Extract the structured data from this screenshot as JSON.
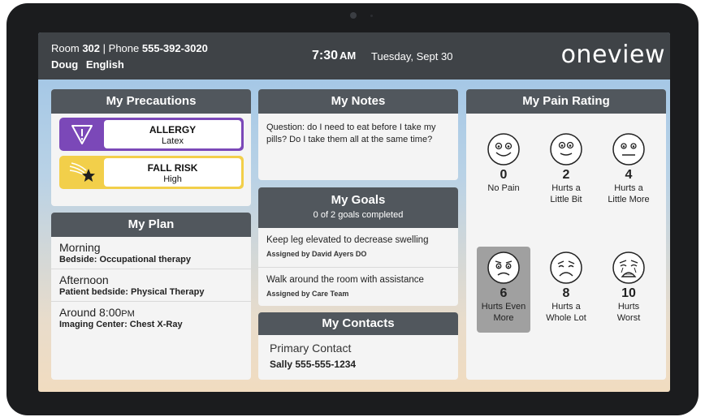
{
  "header": {
    "room_label": "Room",
    "room_number": "302",
    "separator": "|",
    "phone_label": "Phone",
    "phone_number": "555-392-3020",
    "patient_name": "Doug",
    "language": "English",
    "time": "7:30",
    "ampm": "AM",
    "date": "Tuesday, Sept 30",
    "logo": "oneview"
  },
  "precautions": {
    "title": "My Precautions",
    "items": [
      {
        "title": "ALLERGY",
        "detail": "Latex",
        "color": "#7b48b8",
        "icon": "warning-triangle-icon"
      },
      {
        "title": "FALL RISK",
        "detail": "High",
        "color": "#f2cf4a",
        "icon": "falling-star-icon"
      }
    ]
  },
  "plan": {
    "title": "My Plan",
    "items": [
      {
        "time": "Morning",
        "time_suffix": "",
        "detail": "Bedside: Occupational therapy"
      },
      {
        "time": "Afternoon",
        "time_suffix": "",
        "detail": "Patient bedside: Physical Therapy"
      },
      {
        "time": "Around 8:00",
        "time_suffix": "PM",
        "detail": "Imaging Center: Chest X-Ray"
      }
    ]
  },
  "notes": {
    "title": "My Notes",
    "text": "Question: do I need to eat before I take my pills? Do I take them all at the same time?"
  },
  "goals": {
    "title": "My Goals",
    "count_text": "0 of 2 goals completed",
    "items": [
      {
        "goal": "Keep leg elevated to decrease swelling",
        "assigned": "Assigned by David Ayers DO"
      },
      {
        "goal": "Walk around the room with assistance",
        "assigned": "Assigned by Care Team"
      }
    ]
  },
  "contacts": {
    "title": "My Contacts",
    "label": "Primary Contact",
    "value": "Sally 555-555-1234"
  },
  "pain": {
    "title": "My Pain Rating",
    "selected": "6",
    "items": [
      {
        "value": "0",
        "line1": "No Pain",
        "line2": ""
      },
      {
        "value": "2",
        "line1": "Hurts a",
        "line2": "Little Bit"
      },
      {
        "value": "4",
        "line1": "Hurts a",
        "line2": "Little More"
      },
      {
        "value": "6",
        "line1": "Hurts Even",
        "line2": "More"
      },
      {
        "value": "8",
        "line1": "Hurts a",
        "line2": "Whole Lot"
      },
      {
        "value": "10",
        "line1": "Hurts",
        "line2": "Worst"
      }
    ]
  }
}
